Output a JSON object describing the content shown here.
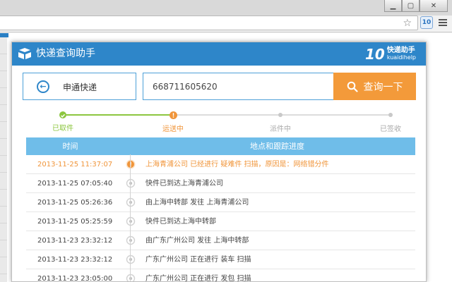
{
  "browser": {
    "window_buttons": [
      "▁",
      "▢",
      "✕"
    ],
    "star_glyph": "☆",
    "extension_glyph": "10"
  },
  "popup": {
    "title": "快递查询助手",
    "brand": {
      "mark": "10",
      "name_cn": "快递助手",
      "name_en": "kuaidihelp"
    },
    "company": "申通快递",
    "tracking_number": "668711605620",
    "query_button": "查询一下",
    "steps": [
      {
        "label": "已取件",
        "state": "done"
      },
      {
        "label": "运送中",
        "state": "current"
      },
      {
        "label": "派件中",
        "state": "pending"
      },
      {
        "label": "已签收",
        "state": "pending"
      }
    ],
    "table": {
      "headers": {
        "time": "时间",
        "detail": "地点和跟踪进度"
      },
      "rows": [
        {
          "time": "2013-11-25 11:37:07",
          "detail": "上海青浦公司 已经进行 疑难件 扫描，原因是：网络错分件",
          "latest": true
        },
        {
          "time": "2013-11-25 07:05:40",
          "detail": "快件已到达上海青浦公司",
          "latest": false
        },
        {
          "time": "2013-11-25 05:26:36",
          "detail": "由上海中转部 发往 上海青浦公司",
          "latest": false
        },
        {
          "time": "2013-11-25 05:25:59",
          "detail": "快件已到达上海中转部",
          "latest": false
        },
        {
          "time": "2013-11-23 23:32:12",
          "detail": "由广东广州公司 发往 上海中转部",
          "latest": false
        },
        {
          "time": "2013-11-23 23:32:12",
          "detail": "广东广州公司 正在进行 装车 扫描",
          "latest": false
        },
        {
          "time": "2013-11-23 23:05:00",
          "detail": "广东广州公司 正在进行 发包 扫描",
          "latest": false
        }
      ]
    }
  },
  "colors": {
    "header_blue": "#2e86c9",
    "table_header": "#6fbde9",
    "accent_orange": "#f39a3a",
    "step_done": "#8cc63f",
    "step_current": "#f0953a",
    "step_pending": "#c8c8c8"
  },
  "icons": [
    "box-logo-icon",
    "back-arrow-icon",
    "search-icon",
    "warning-icon",
    "timeline-node-icon",
    "star-icon",
    "extension-icon",
    "menu-icon"
  ]
}
